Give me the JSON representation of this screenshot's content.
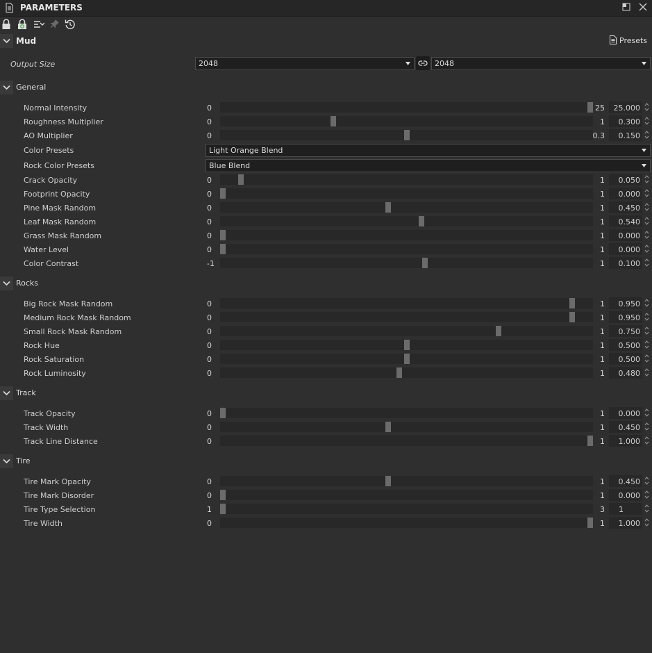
{
  "panel": {
    "title": "PARAMETERS"
  },
  "material": {
    "name": "Mud",
    "presets_label": "Presets"
  },
  "output_size": {
    "label": "Output Size",
    "width_value": "2048",
    "height_value": "2048"
  },
  "groups": {
    "general": {
      "label": "General"
    },
    "rocks": {
      "label": "Rocks"
    },
    "track": {
      "label": "Track"
    },
    "tire": {
      "label": "Tire"
    }
  },
  "params": {
    "normal_intensity": {
      "label": "Normal Intensity",
      "min": "0",
      "max": "25",
      "value": "25.000",
      "fraction": 1.0
    },
    "roughness_multiplier": {
      "label": "Roughness Multiplier",
      "min": "0",
      "max": "1",
      "value": "0.300",
      "fraction": 0.3
    },
    "ao_multiplier": {
      "label": "AO Multiplier",
      "min": "0",
      "max": "0.3",
      "value": "0.150",
      "fraction": 0.5
    },
    "color_presets": {
      "label": "Color Presets",
      "value": "Light Orange Blend"
    },
    "rock_color_presets": {
      "label": "Rock Color Presets",
      "value": "Blue Blend"
    },
    "crack_opacity": {
      "label": "Crack Opacity",
      "min": "0",
      "max": "1",
      "value": "0.050",
      "fraction": 0.05
    },
    "footprint_opacity": {
      "label": "Footprint Opacity",
      "min": "0",
      "max": "1",
      "value": "0.000",
      "fraction": 0.0
    },
    "pine_mask_random": {
      "label": "Pine Mask Random",
      "min": "0",
      "max": "1",
      "value": "0.450",
      "fraction": 0.45
    },
    "leaf_mask_random": {
      "label": "Leaf Mask Random",
      "min": "0",
      "max": "1",
      "value": "0.540",
      "fraction": 0.54
    },
    "grass_mask_random": {
      "label": "Grass Mask Random",
      "min": "0",
      "max": "1",
      "value": "0.000",
      "fraction": 0.0
    },
    "water_level": {
      "label": "Water Level",
      "min": "0",
      "max": "1",
      "value": "0.000",
      "fraction": 0.0
    },
    "color_contrast": {
      "label": "Color Contrast",
      "min": "-1",
      "max": "1",
      "value": "0.100",
      "fraction": 0.55
    },
    "big_rock_mask_random": {
      "label": "Big Rock Mask Random",
      "min": "0",
      "max": "1",
      "value": "0.950",
      "fraction": 0.95
    },
    "medium_rock_mask_random": {
      "label": "Medium Rock Mask Random",
      "min": "0",
      "max": "1",
      "value": "0.950",
      "fraction": 0.95
    },
    "small_rock_mask_random": {
      "label": "Small Rock Mask Random",
      "min": "0",
      "max": "1",
      "value": "0.750",
      "fraction": 0.75
    },
    "rock_hue": {
      "label": "Rock Hue",
      "min": "0",
      "max": "1",
      "value": "0.500",
      "fraction": 0.5
    },
    "rock_saturation": {
      "label": "Rock Saturation",
      "min": "0",
      "max": "1",
      "value": "0.500",
      "fraction": 0.5
    },
    "rock_luminosity": {
      "label": "Rock Luminosity",
      "min": "0",
      "max": "1",
      "value": "0.480",
      "fraction": 0.48
    },
    "track_opacity": {
      "label": "Track Opacity",
      "min": "0",
      "max": "1",
      "value": "0.000",
      "fraction": 0.0
    },
    "track_width": {
      "label": "Track Width",
      "min": "0",
      "max": "1",
      "value": "0.450",
      "fraction": 0.45
    },
    "track_line_distance": {
      "label": "Track Line Distance",
      "min": "0",
      "max": "1",
      "value": "1.000",
      "fraction": 1.0
    },
    "tire_mark_opacity": {
      "label": "Tire Mark Opacity",
      "min": "0",
      "max": "1",
      "value": "0.450",
      "fraction": 0.45
    },
    "tire_mark_disorder": {
      "label": "Tire Mark Disorder",
      "min": "0",
      "max": "1",
      "value": "0.000",
      "fraction": 0.0
    },
    "tire_type_selection": {
      "label": "Tire Type Selection",
      "min": "1",
      "max": "3",
      "value": "1",
      "fraction": 0.0
    },
    "tire_width": {
      "label": "Tire Width",
      "min": "0",
      "max": "1",
      "value": "1.000",
      "fraction": 1.0
    }
  }
}
